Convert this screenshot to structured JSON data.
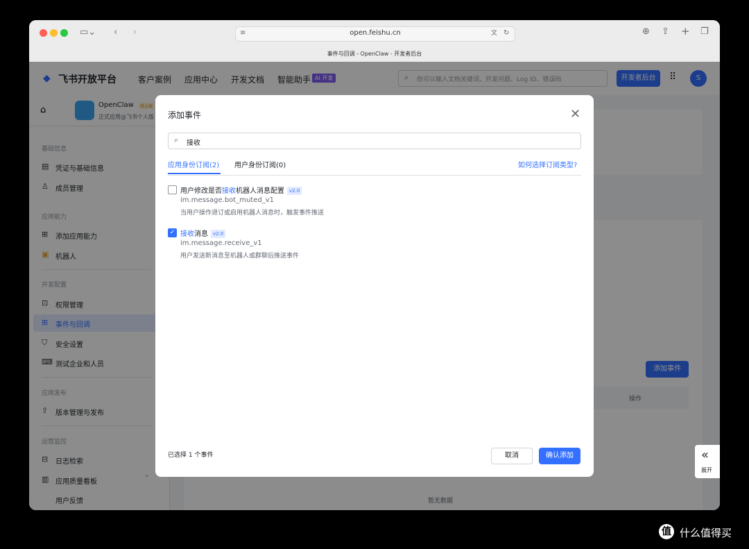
{
  "browser": {
    "url": "open.feishu.cn",
    "tab_title": "事件与回调 - OpenClaw - 开发者后台"
  },
  "topnav": {
    "brand": "飞书开放平台",
    "items": [
      "客户案例",
      "应用中心",
      "开发文档",
      "智能助手"
    ],
    "ai_badge": "AI 开发",
    "search_placeholder": "你可以输入文档关键词、开发问题、Log ID、错误码",
    "dev_console": "开发者后台",
    "avatar_initial": "S"
  },
  "app": {
    "name": "OpenClaw",
    "status": "待上线",
    "subtitle": "正式应用@飞书个人版"
  },
  "sidebar": {
    "sections": [
      {
        "title": "基础信息",
        "items": [
          "凭证与基础信息",
          "成员管理"
        ]
      },
      {
        "title": "应用能力",
        "items": [
          "添加应用能力",
          "机器人"
        ]
      },
      {
        "title": "开发配置",
        "items": [
          "权限管理",
          "事件与回调",
          "安全设置",
          "测试企业和人员"
        ]
      },
      {
        "title": "应用发布",
        "items": [
          "版本管理与发布"
        ]
      },
      {
        "title": "运营监控",
        "items": [
          "日志检索",
          "应用质量看板",
          "用户反馈"
        ]
      }
    ],
    "active": "事件与回调"
  },
  "main": {
    "add_event": "添加事件",
    "col_action": "操作",
    "empty": "暂无数据"
  },
  "modal": {
    "title": "添加事件",
    "search_value": "接收",
    "tabs": [
      "应用身份订阅(2)",
      "用户身份订阅(0)"
    ],
    "help_link": "如何选择订阅类型?",
    "events": [
      {
        "name_pre": "用户修改是否",
        "name_hl": "接收",
        "name_post": "机器人消息配置",
        "version": "v2.0",
        "id": "im.message.bot_muted_v1",
        "desc": "当用户操作退订或启用机器人消息时，触发事件推送",
        "checked": false
      },
      {
        "name_pre": "",
        "name_hl": "接收",
        "name_post": "消息",
        "version": "v2.0",
        "id": "im.message.receive_v1",
        "desc": "用户发送新消息至机器人或群聊后推送事件",
        "checked": true
      }
    ],
    "selected_count": "已选择 1 个事件",
    "cancel": "取消",
    "confirm": "确认添加"
  },
  "expand": "展开",
  "watermark": "什么值得买",
  "colors": {
    "accent": "#3370ff",
    "overlay": "rgba(0,0,0,0.45)"
  }
}
